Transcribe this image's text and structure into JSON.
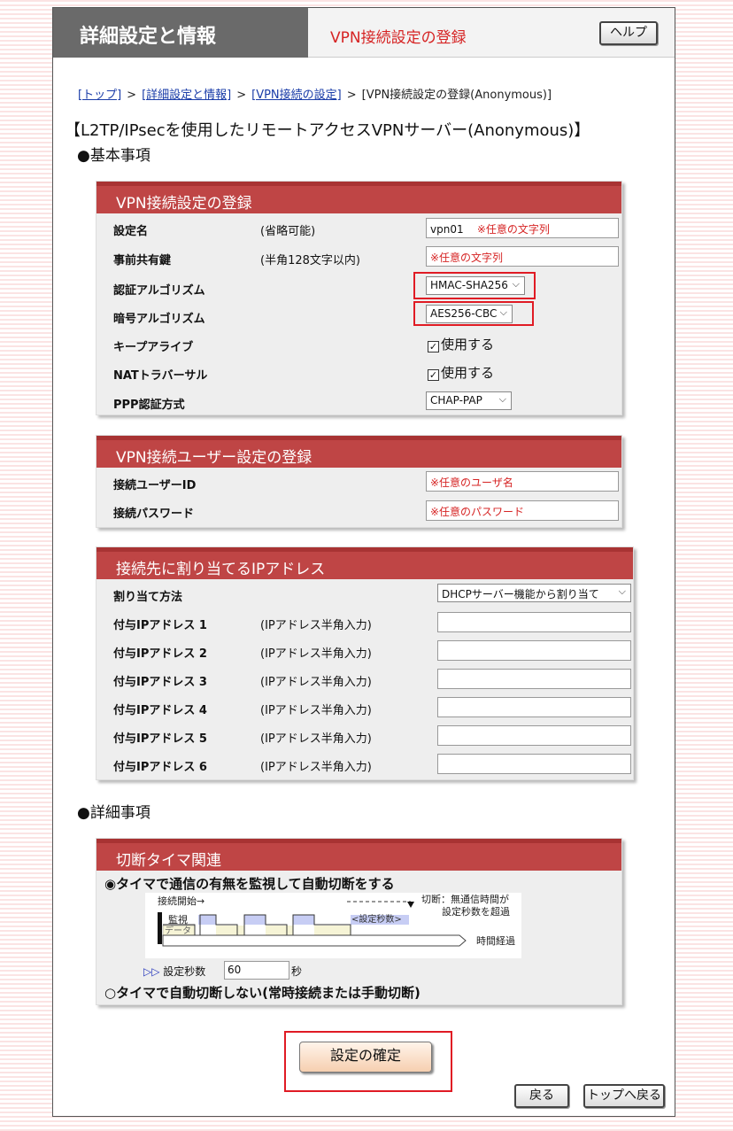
{
  "header": {
    "title": "詳細設定と情報",
    "subtitle": "VPN接続設定の登録",
    "help_label": "ヘルプ"
  },
  "breadcrumb": {
    "items": [
      "[トップ]",
      "[詳細設定と情報]",
      "[VPN接続の設定]"
    ],
    "current": "[VPN接続設定の登録(Anonymous)]",
    "separator": ">"
  },
  "page_heading": "【L2TP/IPsecを使用したリモートアクセスVPNサーバー(Anonymous)】",
  "section_basic": "●基本事項",
  "section_detail": "●詳細事項",
  "vpn_settings": {
    "title": "VPN接続設定の登録",
    "setting_name": {
      "label": "設定名",
      "note": "(省略可能)",
      "value": "vpn01",
      "hint": "※任意の文字列"
    },
    "psk": {
      "label": "事前共有鍵",
      "note": "(半角128文字以内)",
      "hint": "※任意の文字列"
    },
    "auth_algorithm": {
      "label": "認証アルゴリズム",
      "value": "HMAC-SHA256"
    },
    "enc_algorithm": {
      "label": "暗号アルゴリズム",
      "value": "AES256-CBC"
    },
    "keepalive": {
      "label": "キープアライブ",
      "option": "使用する",
      "checked": true
    },
    "nat_traversal": {
      "label": "NATトラバーサル",
      "option": "使用する",
      "checked": true
    },
    "ppp_auth": {
      "label": "PPP認証方式",
      "value": "CHAP-PAP"
    }
  },
  "user_settings": {
    "title": "VPN接続ユーザー設定の登録",
    "user_id": {
      "label": "接続ユーザーID",
      "hint": "※任意のユーザ名"
    },
    "password": {
      "label": "接続パスワード",
      "hint": "※任意のパスワード"
    }
  },
  "ip_assign": {
    "title": "接続先に割り当てるIPアドレス",
    "method": {
      "label": "割り当て方法",
      "value": "DHCPサーバー機能から割り当て"
    },
    "addresses": [
      {
        "label": "付与IPアドレス 1",
        "note": "(IPアドレス半角入力)",
        "value": ""
      },
      {
        "label": "付与IPアドレス 2",
        "note": "(IPアドレス半角入力)",
        "value": ""
      },
      {
        "label": "付与IPアドレス 3",
        "note": "(IPアドレス半角入力)",
        "value": ""
      },
      {
        "label": "付与IPアドレス 4",
        "note": "(IPアドレス半角入力)",
        "value": ""
      },
      {
        "label": "付与IPアドレス 5",
        "note": "(IPアドレス半角入力)",
        "value": ""
      },
      {
        "label": "付与IPアドレス 6",
        "note": "(IPアドレス半角入力)",
        "value": ""
      }
    ]
  },
  "timer": {
    "title": "切断タイマ関連",
    "option_monitor": "タイマで通信の有無を監視して自動切断をする",
    "option_none": "タイマで自動切断しない(常時接続または手動切断)",
    "selected": "monitor",
    "diagram": {
      "start_label": "接続開始→",
      "monitor_label": "監視",
      "data_label": "データ",
      "setting_seconds_label": "<設定秒数>",
      "cut_label_1": "切断：無通信時間が",
      "cut_label_2": "設定秒数を超過",
      "time_label": "時間経過"
    },
    "seconds_prefix": "▷▷",
    "seconds_label": "設定秒数",
    "seconds_value": "60",
    "seconds_unit": "秒"
  },
  "buttons": {
    "confirm": "設定の確定",
    "back": "戻る",
    "top": "トップへ戻る"
  }
}
